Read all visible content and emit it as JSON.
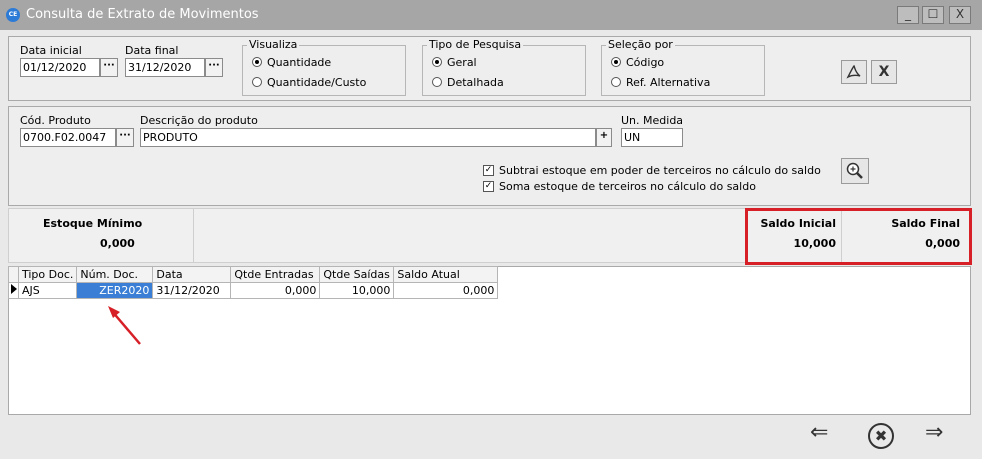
{
  "window": {
    "title": "Consulta de Extrato de Movimentos",
    "icon_text": "CE",
    "minimize": "_",
    "maximize": "☐",
    "close": "X"
  },
  "filters": {
    "data_inicial_label": "Data inicial",
    "data_inicial_value": "01/12/2020",
    "data_final_label": "Data final",
    "data_final_value": "31/12/2020",
    "dots": "···"
  },
  "visualiza": {
    "title": "Visualiza",
    "options": [
      "Quantidade",
      "Quantidade/Custo"
    ],
    "selected": 0
  },
  "tipo_pesquisa": {
    "title": "Tipo de Pesquisa",
    "options": [
      "Geral",
      "Detalhada"
    ],
    "selected": 0
  },
  "selecao_por": {
    "title": "Seleção por",
    "options": [
      "Código",
      "Ref. Alternativa"
    ],
    "selected": 0
  },
  "product": {
    "codigo_label": "Cód. Produto",
    "codigo_value": "0700.F02.0047",
    "descricao_label": "Descrição do produto",
    "descricao_value": "PRODUTO",
    "plus": "+",
    "unidade_label": "Un. Medida",
    "unidade_value": "UN"
  },
  "options": {
    "subtrai_label": "Subtrai estoque em poder de terceiros no cálculo do saldo",
    "soma_label": "Soma estoque de terceiros no cálculo do saldo",
    "check_mark": "✓"
  },
  "summary": {
    "estoque_minimo_label": "Estoque Mínimo",
    "estoque_minimo_value": "0,000",
    "saldo_inicial_label": "Saldo Inicial",
    "saldo_inicial_value": "10,000",
    "saldo_final_label": "Saldo Final",
    "saldo_final_value": "0,000"
  },
  "grid": {
    "headers": [
      "Tipo Doc.",
      "Núm. Doc.",
      "Data",
      "Qtde Entradas",
      "Qtde Saídas",
      "Saldo Atual"
    ],
    "rows": [
      [
        "AJS",
        "ZER2020",
        "31/12/2020",
        "0,000",
        "10,000",
        "0,000"
      ]
    ]
  },
  "nav": {
    "prev": "⇐",
    "cancel": "✖",
    "next": "⇒"
  },
  "colors": {
    "highlight": "#3a7fd5",
    "annotation": "#d61f26"
  }
}
